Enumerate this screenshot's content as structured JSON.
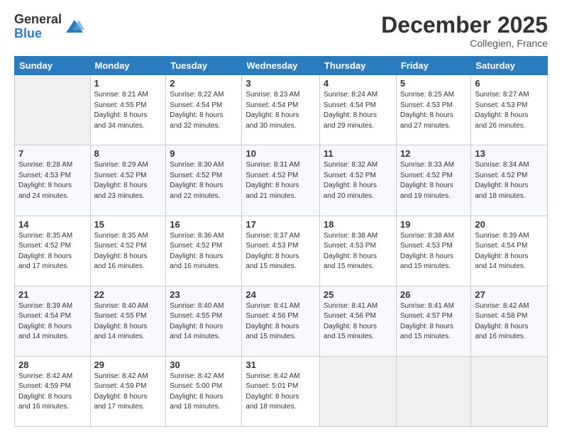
{
  "logo": {
    "general": "General",
    "blue": "Blue"
  },
  "title": "December 2025",
  "subtitle": "Collegien, France",
  "days_header": [
    "Sunday",
    "Monday",
    "Tuesday",
    "Wednesday",
    "Thursday",
    "Friday",
    "Saturday"
  ],
  "weeks": [
    [
      {
        "day": "",
        "info": ""
      },
      {
        "day": "1",
        "info": "Sunrise: 8:21 AM\nSunset: 4:55 PM\nDaylight: 8 hours\nand 34 minutes."
      },
      {
        "day": "2",
        "info": "Sunrise: 8:22 AM\nSunset: 4:54 PM\nDaylight: 8 hours\nand 32 minutes."
      },
      {
        "day": "3",
        "info": "Sunrise: 8:23 AM\nSunset: 4:54 PM\nDaylight: 8 hours\nand 30 minutes."
      },
      {
        "day": "4",
        "info": "Sunrise: 8:24 AM\nSunset: 4:54 PM\nDaylight: 8 hours\nand 29 minutes."
      },
      {
        "day": "5",
        "info": "Sunrise: 8:25 AM\nSunset: 4:53 PM\nDaylight: 8 hours\nand 27 minutes."
      },
      {
        "day": "6",
        "info": "Sunrise: 8:27 AM\nSunset: 4:53 PM\nDaylight: 8 hours\nand 26 minutes."
      }
    ],
    [
      {
        "day": "7",
        "info": "Sunrise: 8:28 AM\nSunset: 4:53 PM\nDaylight: 8 hours\nand 24 minutes."
      },
      {
        "day": "8",
        "info": "Sunrise: 8:29 AM\nSunset: 4:52 PM\nDaylight: 8 hours\nand 23 minutes."
      },
      {
        "day": "9",
        "info": "Sunrise: 8:30 AM\nSunset: 4:52 PM\nDaylight: 8 hours\nand 22 minutes."
      },
      {
        "day": "10",
        "info": "Sunrise: 8:31 AM\nSunset: 4:52 PM\nDaylight: 8 hours\nand 21 minutes."
      },
      {
        "day": "11",
        "info": "Sunrise: 8:32 AM\nSunset: 4:52 PM\nDaylight: 8 hours\nand 20 minutes."
      },
      {
        "day": "12",
        "info": "Sunrise: 8:33 AM\nSunset: 4:52 PM\nDaylight: 8 hours\nand 19 minutes."
      },
      {
        "day": "13",
        "info": "Sunrise: 8:34 AM\nSunset: 4:52 PM\nDaylight: 8 hours\nand 18 minutes."
      }
    ],
    [
      {
        "day": "14",
        "info": "Sunrise: 8:35 AM\nSunset: 4:52 PM\nDaylight: 8 hours\nand 17 minutes."
      },
      {
        "day": "15",
        "info": "Sunrise: 8:35 AM\nSunset: 4:52 PM\nDaylight: 8 hours\nand 16 minutes."
      },
      {
        "day": "16",
        "info": "Sunrise: 8:36 AM\nSunset: 4:52 PM\nDaylight: 8 hours\nand 16 minutes."
      },
      {
        "day": "17",
        "info": "Sunrise: 8:37 AM\nSunset: 4:53 PM\nDaylight: 8 hours\nand 15 minutes."
      },
      {
        "day": "18",
        "info": "Sunrise: 8:38 AM\nSunset: 4:53 PM\nDaylight: 8 hours\nand 15 minutes."
      },
      {
        "day": "19",
        "info": "Sunrise: 8:38 AM\nSunset: 4:53 PM\nDaylight: 8 hours\nand 15 minutes."
      },
      {
        "day": "20",
        "info": "Sunrise: 8:39 AM\nSunset: 4:54 PM\nDaylight: 8 hours\nand 14 minutes."
      }
    ],
    [
      {
        "day": "21",
        "info": "Sunrise: 8:39 AM\nSunset: 4:54 PM\nDaylight: 8 hours\nand 14 minutes."
      },
      {
        "day": "22",
        "info": "Sunrise: 8:40 AM\nSunset: 4:55 PM\nDaylight: 8 hours\nand 14 minutes."
      },
      {
        "day": "23",
        "info": "Sunrise: 8:40 AM\nSunset: 4:55 PM\nDaylight: 8 hours\nand 14 minutes."
      },
      {
        "day": "24",
        "info": "Sunrise: 8:41 AM\nSunset: 4:56 PM\nDaylight: 8 hours\nand 15 minutes."
      },
      {
        "day": "25",
        "info": "Sunrise: 8:41 AM\nSunset: 4:56 PM\nDaylight: 8 hours\nand 15 minutes."
      },
      {
        "day": "26",
        "info": "Sunrise: 8:41 AM\nSunset: 4:57 PM\nDaylight: 8 hours\nand 15 minutes."
      },
      {
        "day": "27",
        "info": "Sunrise: 8:42 AM\nSunset: 4:58 PM\nDaylight: 8 hours\nand 16 minutes."
      }
    ],
    [
      {
        "day": "28",
        "info": "Sunrise: 8:42 AM\nSunset: 4:59 PM\nDaylight: 8 hours\nand 16 minutes."
      },
      {
        "day": "29",
        "info": "Sunrise: 8:42 AM\nSunset: 4:59 PM\nDaylight: 8 hours\nand 17 minutes."
      },
      {
        "day": "30",
        "info": "Sunrise: 8:42 AM\nSunset: 5:00 PM\nDaylight: 8 hours\nand 18 minutes."
      },
      {
        "day": "31",
        "info": "Sunrise: 8:42 AM\nSunset: 5:01 PM\nDaylight: 8 hours\nand 18 minutes."
      },
      {
        "day": "",
        "info": ""
      },
      {
        "day": "",
        "info": ""
      },
      {
        "day": "",
        "info": ""
      }
    ]
  ]
}
